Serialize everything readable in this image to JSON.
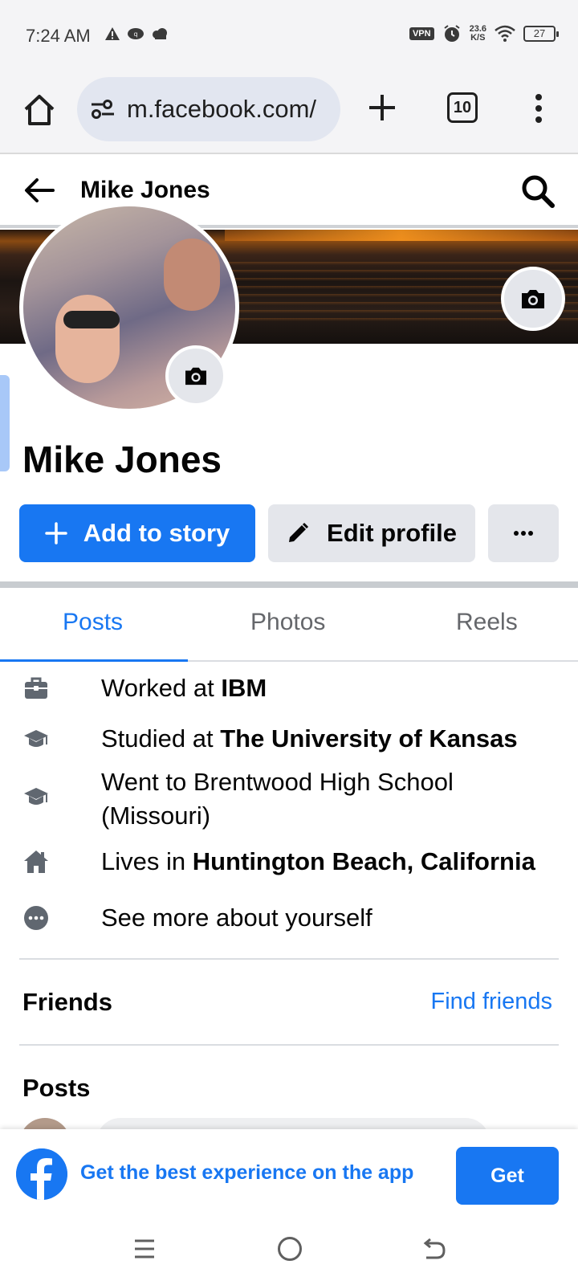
{
  "status_bar": {
    "time": "7:24 AM",
    "vpn": "VPN",
    "net_speed_value": "23.6",
    "net_speed_unit": "K/S",
    "battery": "27"
  },
  "browser": {
    "url": "m.facebook.com/",
    "tab_count": "10"
  },
  "header": {
    "title": "Mike Jones"
  },
  "profile": {
    "name": "Mike Jones",
    "add_story_label": "Add to story",
    "edit_profile_label": "Edit profile"
  },
  "tabs": [
    {
      "label": "Posts",
      "active": true
    },
    {
      "label": "Photos",
      "active": false
    },
    {
      "label": "Reels",
      "active": false
    }
  ],
  "intro": {
    "work_prefix": "Worked at ",
    "work_place": "IBM",
    "study_prefix": "Studied at ",
    "study_place": "The University of Kansas",
    "school_line1": "Went to Brentwood High School",
    "school_line2": "(Missouri)",
    "lives_prefix": "Lives in ",
    "lives_place": "Huntington Beach, California",
    "see_more": "See more about yourself"
  },
  "friends": {
    "title": "Friends",
    "find_friends": "Find friends"
  },
  "posts": {
    "title": "Posts"
  },
  "app_banner": {
    "text": "Get the best experience on the app",
    "button": "Get"
  },
  "colors": {
    "brand_blue": "#1877f2",
    "button_gray": "#e4e6eb"
  }
}
